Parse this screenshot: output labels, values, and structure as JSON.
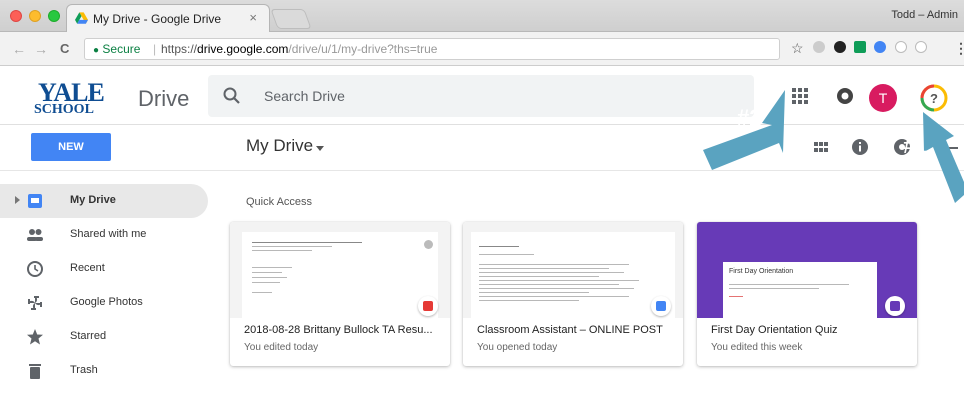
{
  "browser": {
    "tab_title": "My Drive - Google Drive",
    "tab_close": "×",
    "profile_name": "Todd – Admin",
    "secure_label": "Secure",
    "url_scheme": "https://",
    "url_host": "drive.google.com",
    "url_path": "/drive/u/1/my-drive?ths=true",
    "nav": {
      "back": "←",
      "forward": "→",
      "reload": "C"
    },
    "star": "☆",
    "menu": "⋮"
  },
  "logo": {
    "top": "YALE",
    "bottom": "SCHOOL"
  },
  "app_name": "Drive",
  "search": {
    "placeholder": "Search Drive"
  },
  "user": {
    "avatar_letter": "T",
    "avatar_color": "#d81b60"
  },
  "toolbar": {
    "new_label": "NEW",
    "title": "My Drive"
  },
  "sidebar": {
    "items": [
      {
        "label": "My Drive",
        "icon": "drive-icon",
        "active": true
      },
      {
        "label": "Shared with me",
        "icon": "shared-icon"
      },
      {
        "label": "Recent",
        "icon": "clock-icon"
      },
      {
        "label": "Google Photos",
        "icon": "photos-icon"
      },
      {
        "label": "Starred",
        "icon": "star-icon"
      },
      {
        "label": "Trash",
        "icon": "trash-icon"
      }
    ]
  },
  "main": {
    "section_label": "Quick Access",
    "cards": [
      {
        "name": "2018-08-28 Brittany Bullock TA Resu...",
        "subtitle": "You edited today",
        "type": "pdf",
        "badge_color": "#e53935"
      },
      {
        "name": "Classroom Assistant – ONLINE POST",
        "subtitle": "You opened today",
        "type": "doc",
        "badge_color": "#4285f4"
      },
      {
        "name": "First Day Orientation Quiz",
        "subtitle": "You edited this week",
        "type": "form",
        "badge_color": "#673ab7",
        "thumb_title": "First Day Orientation"
      }
    ]
  },
  "annotations": {
    "callout1": "#1",
    "callout2": "#2"
  },
  "colors": {
    "accent": "#4285f4",
    "callout": "#5aa3c0"
  }
}
